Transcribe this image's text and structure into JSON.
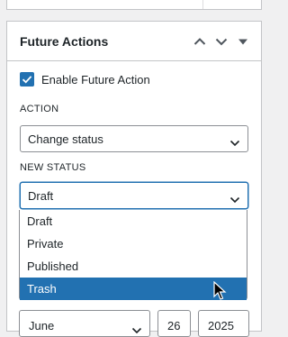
{
  "panel": {
    "title": "Future Actions",
    "header_icons": [
      "chevron-up-icon",
      "chevron-down-icon",
      "caret-down-icon"
    ]
  },
  "enable": {
    "label": "Enable Future Action",
    "checked": true
  },
  "action": {
    "label": "ACTION",
    "value": "Change status"
  },
  "new_status": {
    "label": "NEW STATUS",
    "value": "Draft",
    "options": [
      "Draft",
      "Private",
      "Published",
      "Trash"
    ],
    "highlighted": "Trash"
  },
  "date": {
    "month": "June",
    "day": "26",
    "year": "2025"
  },
  "colors": {
    "accent": "#2271b1",
    "border": "#8c8f94",
    "background": "#f0f0f1"
  }
}
